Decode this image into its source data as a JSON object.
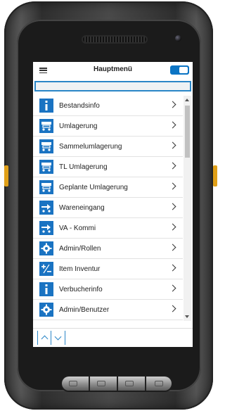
{
  "header": {
    "title": "Hauptmenü"
  },
  "search": {
    "value": "",
    "placeholder": ""
  },
  "menu": {
    "items": [
      {
        "label": "Bestandsinfo",
        "icon": "info-icon"
      },
      {
        "label": "Umlagerung",
        "icon": "forklift-icon"
      },
      {
        "label": "Sammelumlagerung",
        "icon": "forklift-icon"
      },
      {
        "label": "TL Umlagerung",
        "icon": "forklift-icon"
      },
      {
        "label": "Geplante Umlagerung",
        "icon": "forklift-icon"
      },
      {
        "label": "Wareneingang",
        "icon": "truck-icon"
      },
      {
        "label": "VA - Kommi",
        "icon": "truck-icon"
      },
      {
        "label": "Admin/Rollen",
        "icon": "gear-icon"
      },
      {
        "label": "Item Inventur",
        "icon": "plus-minus-icon"
      },
      {
        "label": "Verbucherinfo",
        "icon": "info-icon"
      },
      {
        "label": "Admin/Benutzer",
        "icon": "gear-icon"
      }
    ]
  },
  "colors": {
    "accent": "#1a73c2",
    "search_border": "#2a86c7",
    "device_key": "#e0a018"
  },
  "scroll": {
    "position": 0.0
  }
}
